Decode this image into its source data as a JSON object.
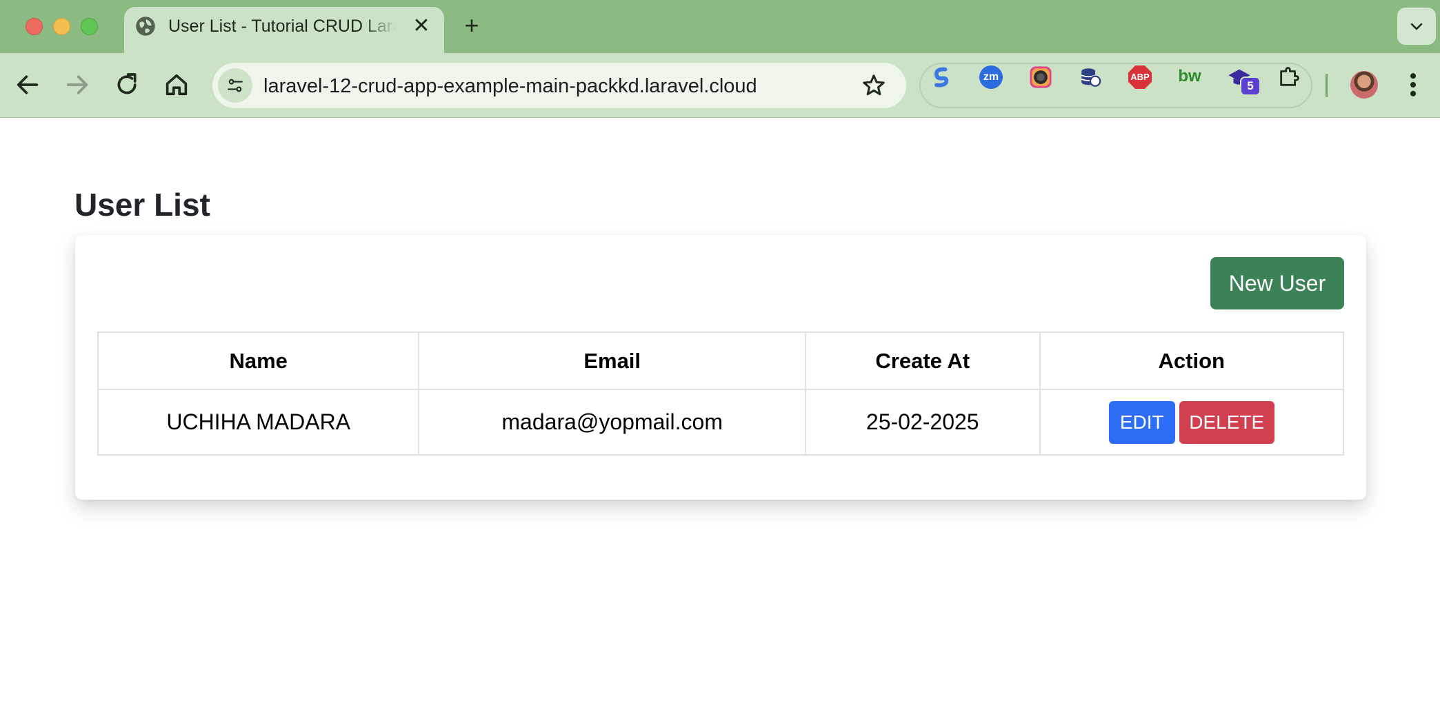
{
  "browser": {
    "tab_title": "User List - Tutorial CRUD Laravel",
    "url": "laravel-12-crud-app-example-main-packkd.laravel.cloud",
    "extension_badge": "5",
    "extensions": [
      "s-icon",
      "zm-icon",
      "camera-icon",
      "database-icon",
      "adblock-icon",
      "bw-icon",
      "graduation-cap-icon",
      "puzzle-icon"
    ],
    "extension_labels": {
      "zm": "zm",
      "abp": "ABP",
      "bw": "bw"
    }
  },
  "page": {
    "title": "User List",
    "new_user_label": "New User"
  },
  "table": {
    "headers": [
      "Name",
      "Email",
      "Create At",
      "Action"
    ],
    "rows": [
      {
        "name": "UCHIHA MADARA",
        "email": "madara@yopmail.com",
        "created_at": "25-02-2025",
        "edit_label": "EDIT",
        "delete_label": "DELETE"
      }
    ]
  },
  "colors": {
    "chrome_green": "#8bbb82",
    "new_user_button": "#3d8157",
    "edit_button": "#2d6df6",
    "delete_button": "#d0404e"
  }
}
